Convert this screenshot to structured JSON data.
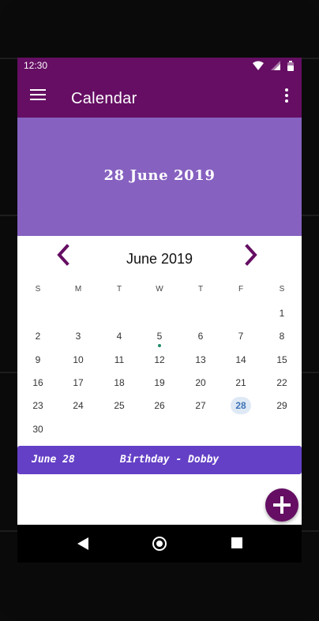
{
  "status_bar": {
    "time": "12:30"
  },
  "toolbar": {
    "title": "Calendar"
  },
  "banner": {
    "selected_date_text": "28 June 2019"
  },
  "calendar": {
    "month_label": "June 2019",
    "weekday_labels": [
      "S",
      "M",
      "T",
      "W",
      "T",
      "F",
      "S"
    ],
    "days": [
      "1",
      "2",
      "3",
      "4",
      "5",
      "6",
      "7",
      "8",
      "9",
      "10",
      "11",
      "12",
      "13",
      "14",
      "15",
      "16",
      "17",
      "18",
      "19",
      "20",
      "21",
      "22",
      "23",
      "24",
      "25",
      "26",
      "27",
      "28",
      "29",
      "30"
    ],
    "first_weekday_index": 6,
    "selected_day": "28",
    "event_days": [
      "5"
    ]
  },
  "event": {
    "date_label": "June 28",
    "title": "Birthday - Dobby"
  },
  "icons": {
    "menu": "hamburger-menu-icon",
    "overflow": "more-vert-icon",
    "prev": "chevron-left-icon",
    "next": "chevron-right-icon",
    "fab": "add-icon",
    "wifi": "wifi-icon",
    "signal": "signal-icon",
    "battery": "battery-icon"
  },
  "colors": {
    "primary": "#650e63",
    "banner": "#8661c0",
    "event_bar": "#6440c6",
    "selected_day_bg": "#dfe9f6",
    "selected_day_text": "#3e73b6",
    "event_dot": "#1f8a6a"
  }
}
